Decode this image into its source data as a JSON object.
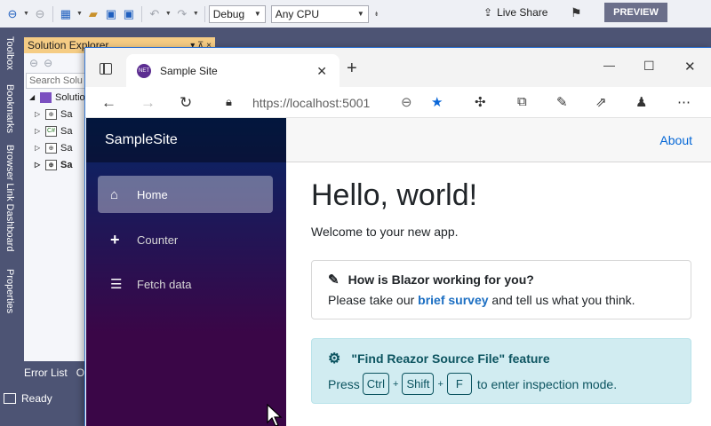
{
  "vs": {
    "toolbar": {
      "config": "Debug",
      "platform": "Any CPU",
      "live_share": "Live Share",
      "preview": "PREVIEW"
    },
    "side_tabs": [
      "Toolbox",
      "Bookmarks",
      "Browser Link Dashboard",
      "Properties"
    ],
    "solution_explorer": {
      "title": "Solution Explorer",
      "search_placeholder": "Search Solu",
      "root": "Solution",
      "projects": [
        {
          "label": "Sa",
          "icon": "web-project-icon"
        },
        {
          "label": "Sa",
          "icon": "csharp-project-icon"
        },
        {
          "label": "Sa",
          "icon": "web-project-icon"
        },
        {
          "label": "Sa",
          "icon": "web-project-icon"
        }
      ]
    },
    "bottom_tabs": [
      "Error List",
      "O"
    ],
    "status": "Ready"
  },
  "browser": {
    "tab_title": "Sample Site",
    "favicon_text": "NET",
    "url": "https://localhost:5001"
  },
  "app": {
    "brand": "SampleSite",
    "nav": [
      {
        "label": "Home",
        "icon": "home-icon",
        "active": true
      },
      {
        "label": "Counter",
        "icon": "plus-icon",
        "active": false
      },
      {
        "label": "Fetch data",
        "icon": "list-icon",
        "active": false
      }
    ],
    "about": "About",
    "heading": "Hello, world!",
    "welcome": "Welcome to your new app.",
    "survey": {
      "title": "How is Blazor working for you?",
      "prefix": "Please take our ",
      "link": "brief survey",
      "suffix": " and tell us what you think."
    },
    "feature": {
      "title": "\"Find Reazor Source File\" feature",
      "prefix": "Press",
      "keys": [
        "Ctrl",
        "Shift",
        "F"
      ],
      "suffix": "to enter inspection mode."
    }
  }
}
